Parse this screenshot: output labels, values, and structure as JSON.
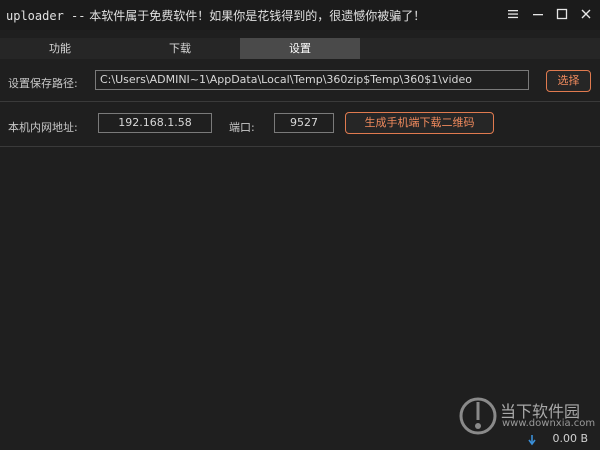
{
  "window": {
    "title_prefix": "uploader --",
    "title_text": " 本软件属于免费软件！如果你是花钱得到的，很遗憾你被骗了！"
  },
  "tabs": [
    {
      "label": "功能",
      "active": false
    },
    {
      "label": "下载",
      "active": false
    },
    {
      "label": "设置",
      "active": true
    }
  ],
  "settings": {
    "save_path_label": "设置保存路径:",
    "save_path_value": "C:\\Users\\ADMINI~1\\AppData\\Local\\Temp\\360zip$Temp\\360$1\\video",
    "choose_button": "选择",
    "ip_label": "本机内网地址:",
    "ip_value": "192.168.1.58",
    "port_label": "端口:",
    "port_value": "9527",
    "qr_button": "生成手机端下载二维码"
  },
  "watermark": {
    "text": "当下软件园",
    "url": "www.downxia.com"
  },
  "status": {
    "size": "0.00 B"
  },
  "colors": {
    "accent": "#f08a5d",
    "background": "#1f1f1f",
    "active_tab": "#4a4a4a"
  }
}
